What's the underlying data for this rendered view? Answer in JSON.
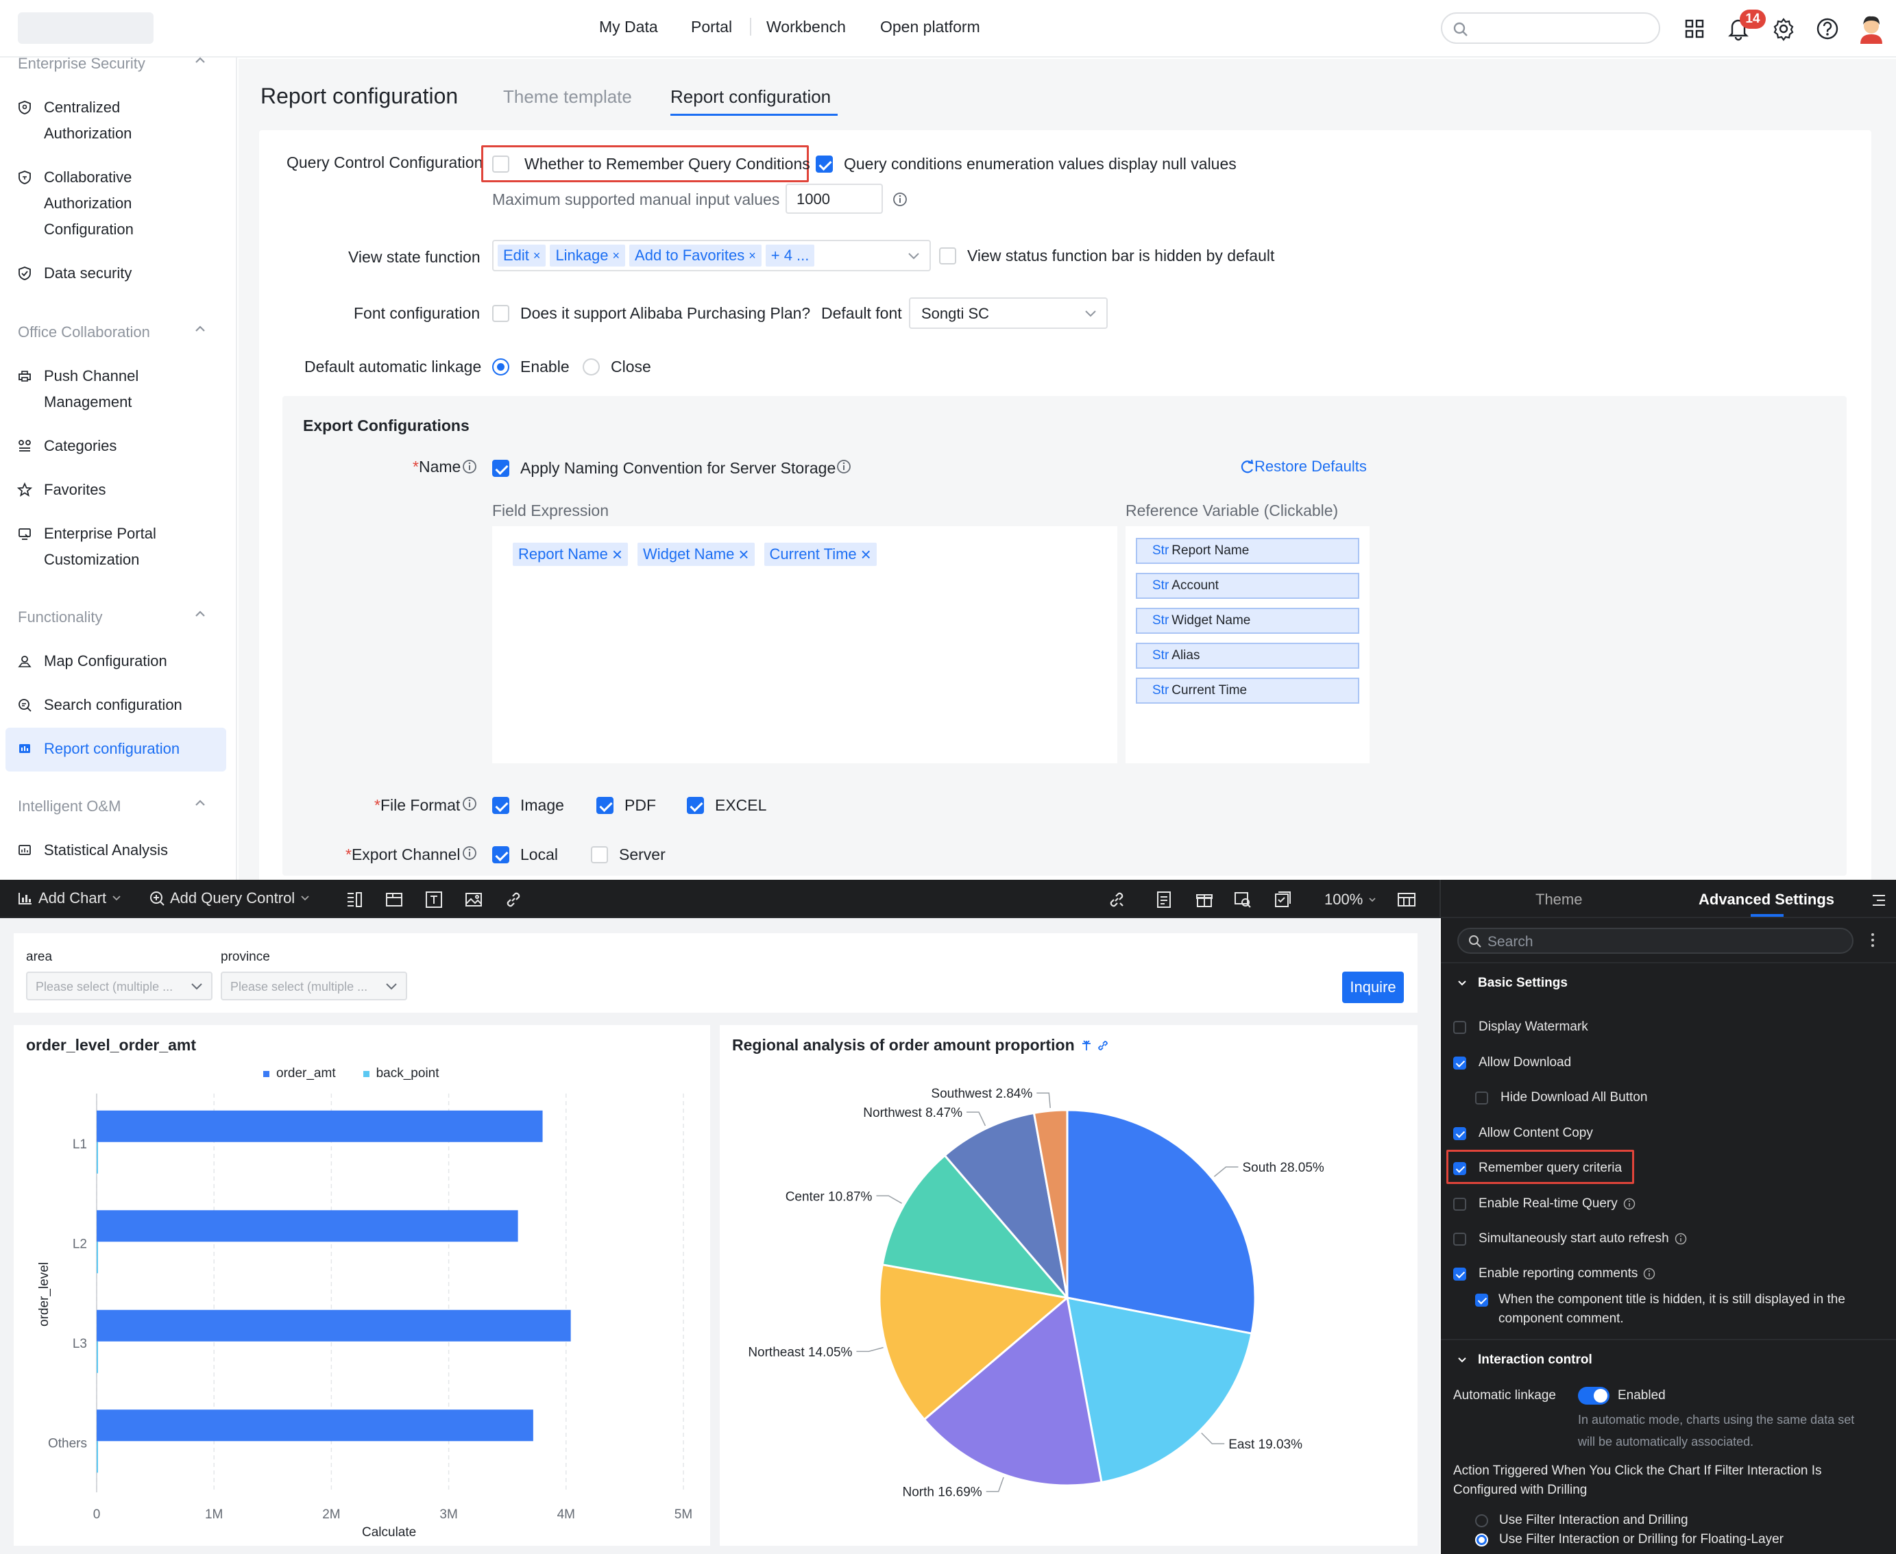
{
  "top_nav": {
    "items": [
      "My Data",
      "Portal",
      "Workbench",
      "Open platform"
    ],
    "notification_count": "14"
  },
  "sidebar": {
    "sections": [
      {
        "title": "Enterprise Security",
        "items": [
          [
            "Centralized",
            "Authorization"
          ],
          [
            "Collaborative",
            "Authorization",
            "Configuration"
          ],
          [
            "Data security"
          ]
        ]
      },
      {
        "title": "Office Collaboration",
        "items": [
          [
            "Push Channel",
            "Management"
          ],
          [
            "Categories"
          ],
          [
            "Favorites"
          ],
          [
            "Enterprise Portal",
            "Customization"
          ]
        ]
      },
      {
        "title": "Functionality",
        "items": [
          [
            "Map Configuration"
          ],
          [
            "Search configuration"
          ],
          [
            "Report configuration"
          ]
        ]
      },
      {
        "title": "Intelligent O&M",
        "items": [
          [
            "Statistical Analysis"
          ]
        ]
      }
    ]
  },
  "page": {
    "title": "Report configuration",
    "tabs": [
      "Theme template",
      "Report configuration"
    ],
    "active_tab": 1
  },
  "query_control": {
    "label": "Query Control Configuration",
    "remember_label": "Whether to Remember Query Conditions",
    "remember_checked": false,
    "null_values_label": "Query conditions enumeration values display null values",
    "null_values_checked": true,
    "max_input_label": "Maximum supported manual input values",
    "max_input_value": "1000"
  },
  "view_state": {
    "label": "View state function",
    "tags": [
      "Edit",
      "Linkage",
      "Add to Favorites"
    ],
    "more": "+ 4 ...",
    "hidden_label": "View status function bar is hidden by default"
  },
  "font_config": {
    "label": "Font configuration",
    "alibaba_label": "Does it support Alibaba Purchasing Plan?",
    "default_font_label": "Default font",
    "default_font_value": "Songti SC"
  },
  "linkage": {
    "label": "Default automatic linkage",
    "enable": "Enable",
    "close": "Close"
  },
  "export": {
    "title": "Export Configurations",
    "name_label": "Name",
    "naming_label": "Apply Naming Convention for Server Storage",
    "restore": "Restore Defaults",
    "field_expr_label": "Field Expression",
    "field_tags": [
      "Report Name",
      "Widget Name",
      "Current Time"
    ],
    "ref_label": "Reference Variable (Clickable)",
    "ref_prefix": "Str",
    "ref_vars": [
      "Report Name",
      "Account",
      "Widget Name",
      "Alias",
      "Current Time"
    ],
    "file_format_label": "File Format",
    "formats": [
      "Image",
      "PDF",
      "EXCEL"
    ],
    "channel_label": "Export Channel",
    "channels": [
      "Local",
      "Server"
    ]
  },
  "editor_toolbar": {
    "add_chart": "Add Chart",
    "add_query": "Add Query Control",
    "zoom": "100%",
    "theme_tab": "Theme",
    "advanced_tab": "Advanced Settings"
  },
  "filters": {
    "area_label": "area",
    "province_label": "province",
    "placeholder": "Please select (multiple ...",
    "inquire": "Inquire"
  },
  "bar_chart": {
    "title": "order_level_order_amt",
    "legend": [
      "order_amt",
      "back_point"
    ],
    "ylabel": "order_level",
    "xlabel": "Calculate"
  },
  "pie_chart": {
    "title": "Regional analysis of order amount proportion"
  },
  "chart_data": [
    {
      "type": "bar",
      "orientation": "horizontal",
      "title": "order_level_order_amt",
      "categories": [
        "L1",
        "L2",
        "L3",
        "Others"
      ],
      "series": [
        {
          "name": "order_amt",
          "values": [
            3800000,
            3590000,
            4040000,
            3720000
          ]
        },
        {
          "name": "back_point",
          "values": [
            0,
            0,
            0,
            0
          ]
        }
      ],
      "xlabel": "Calculate",
      "ylabel": "order_level",
      "xlim": [
        0,
        5000000
      ],
      "xticks": [
        "0",
        "1M",
        "2M",
        "3M",
        "4M",
        "5M"
      ],
      "grid": true,
      "legend": "top-center",
      "colors": [
        "#3a7bf5",
        "#5bc8f2"
      ]
    },
    {
      "type": "pie",
      "title": "Regional analysis of order amount proportion",
      "slices": [
        {
          "label": "South",
          "value": 28.05,
          "text": "South 28.05%",
          "color": "#3a7bf5"
        },
        {
          "label": "East",
          "value": 19.03,
          "text": "East 19.03%",
          "color": "#5ecdf5"
        },
        {
          "label": "North",
          "value": 16.69,
          "text": "North 16.69%",
          "color": "#8b7de8"
        },
        {
          "label": "Northeast",
          "value": 14.05,
          "text": "Northeast 14.05%",
          "color": "#fbc049"
        },
        {
          "label": "Center",
          "value": 10.87,
          "text": "Center 10.87%",
          "color": "#4fd1b5"
        },
        {
          "label": "Northwest",
          "value": 8.47,
          "text": "Northwest 8.47%",
          "color": "#617cbf"
        },
        {
          "label": "Southwest",
          "value": 2.84,
          "text": "Southwest 2.84%",
          "color": "#e8935e"
        }
      ]
    }
  ],
  "advanced": {
    "search_placeholder": "Search",
    "basic_title": "Basic Settings",
    "items": [
      {
        "label": "Display Watermark",
        "checked": false
      },
      {
        "label": "Allow Download",
        "checked": true
      },
      {
        "label": "Hide Download All Button",
        "checked": false,
        "indent": true
      },
      {
        "label": "Allow Content Copy",
        "checked": true
      },
      {
        "label": "Remember query criteria",
        "checked": true
      },
      {
        "label": "Enable Real-time Query",
        "checked": false,
        "info": true
      },
      {
        "label": "Simultaneously start auto refresh",
        "checked": false,
        "info": true
      },
      {
        "label": "Enable reporting comments",
        "checked": true,
        "info": true
      }
    ],
    "comment_sub": [
      "When the component title is hidden, it is still displayed in the",
      "component comment."
    ],
    "interaction_title": "Interaction control",
    "auto_linkage_label": "Automatic linkage",
    "auto_linkage_value": "Enabled",
    "auto_desc": [
      "In automatic mode, charts using the same data set",
      "will be automatically associated."
    ],
    "action_label": [
      "Action Triggered When You Click the Chart If Filter Interaction Is",
      "Configured with Drilling"
    ],
    "action_options": [
      "Use Filter Interaction and Drilling",
      "Use Filter Interaction or Drilling for Floating-Layer"
    ],
    "action_selected": 1
  },
  "colors": {
    "accent": "#1b6ef3",
    "highlight": "#e0443a",
    "dark_bg": "#1e1f21"
  }
}
